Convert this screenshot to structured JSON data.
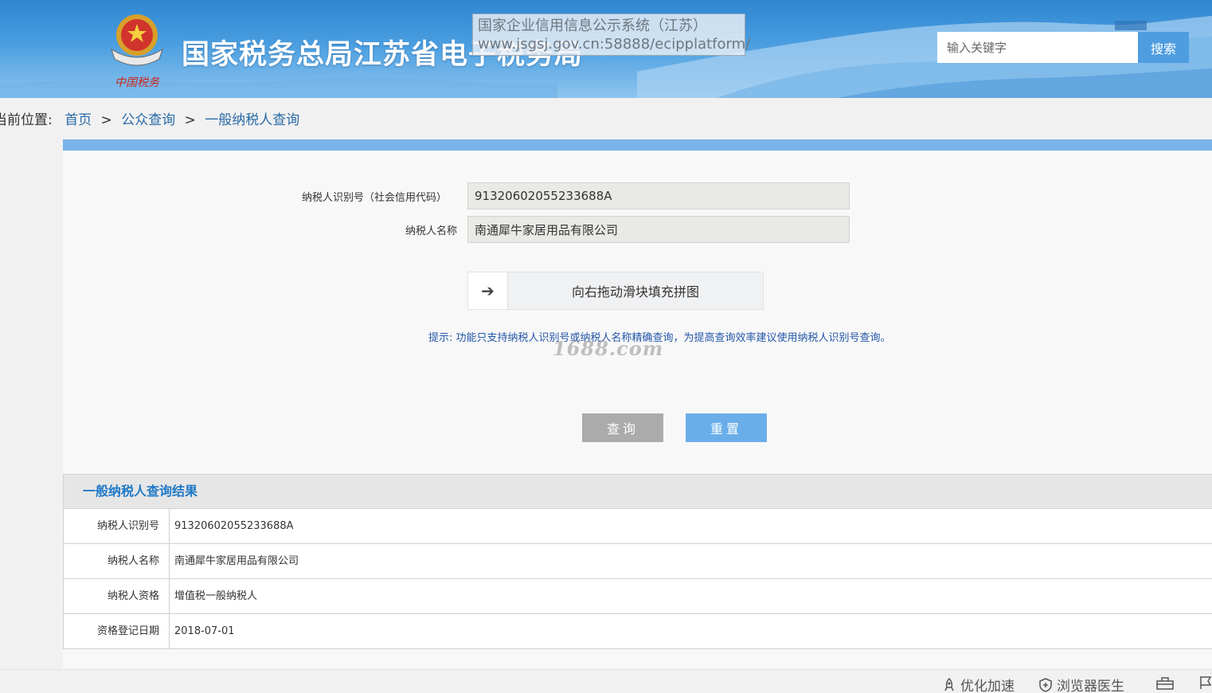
{
  "header": {
    "site_title": "国家税务总局江苏省电子税务局",
    "emblem_caption": "中国税务",
    "tooltip_line1": "国家企业信用信息公示系统（江苏）",
    "tooltip_line2": "www.jsgsj.gov.cn:58888/ecipplatform/",
    "search_placeholder": "输入关键字",
    "search_button": "搜索"
  },
  "breadcrumb": {
    "prefix": "当前位置:",
    "items": [
      "首页",
      "公众查询",
      "一般纳税人查询"
    ],
    "separator": ">"
  },
  "form": {
    "taxpayer_id_label": "纳税人识别号（社会信用代码）",
    "taxpayer_id_value": "91320602055233688A",
    "taxpayer_name_label": "纳税人名称",
    "taxpayer_name_value": "南通犀牛家居用品有限公司",
    "slider_handle": "➔",
    "slider_text": "向右拖动滑块填充拼图",
    "hint": "提示:   功能只支持纳税人识别号或纳税人名称精确查询，为提高查询效率建议使用纳税人识别号查询。",
    "watermark": "1688.com",
    "query_button": "查询",
    "reset_button": "重置"
  },
  "results": {
    "title": "一般纳税人查询结果",
    "rows": [
      {
        "label": "纳税人识别号",
        "value": "91320602055233688A"
      },
      {
        "label": "纳税人名称",
        "value": "南通犀牛家居用品有限公司"
      },
      {
        "label": "纳税人资格",
        "value": "增值税一般纳税人"
      },
      {
        "label": "资格登记日期",
        "value": "2018-07-01"
      }
    ]
  },
  "statusbar": {
    "optimize": "优化加速",
    "doctor": "浏览器医生"
  },
  "colors": {
    "banner": "#4a9ee0",
    "accent": "#1f79c8",
    "link": "#2a6aa8",
    "query_button": "#ababab",
    "reset_button": "#6aaee9"
  }
}
